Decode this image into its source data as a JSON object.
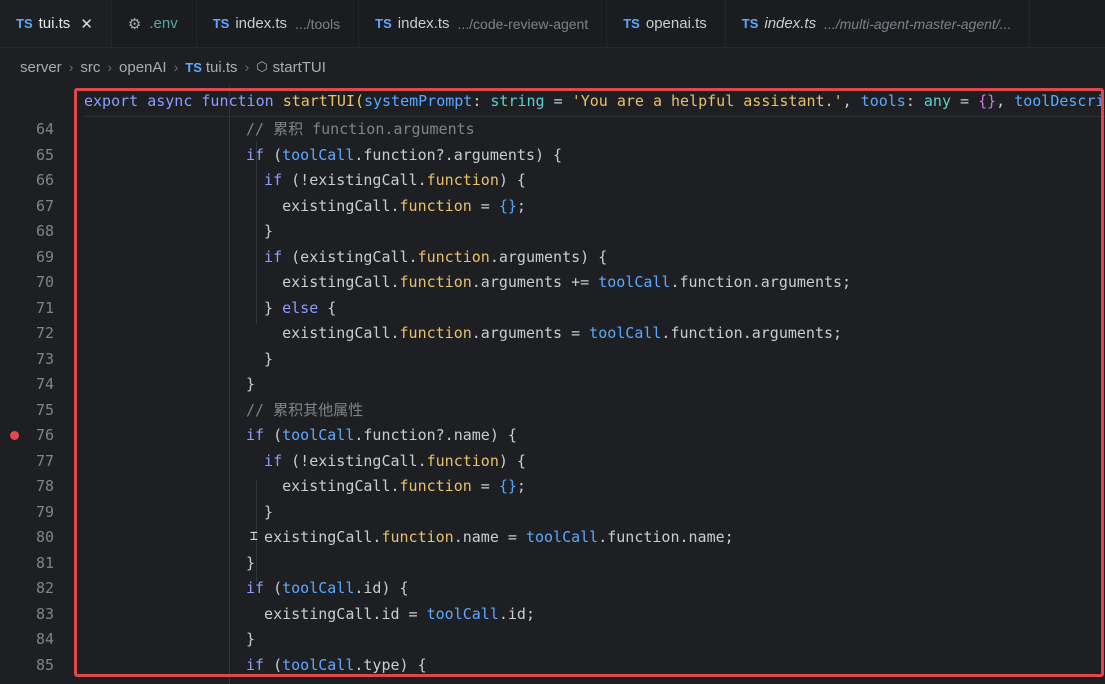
{
  "tabs": [
    {
      "lang": "TS",
      "label": "tui.ts",
      "hint": "",
      "active": true,
      "close": "✕"
    },
    {
      "lang": "⚙",
      "label": ".env",
      "hint": "",
      "active": false
    },
    {
      "lang": "TS",
      "label": "index.ts",
      "hint": ".../tools",
      "active": false
    },
    {
      "lang": "TS",
      "label": "index.ts",
      "hint": ".../code-review-agent",
      "active": false
    },
    {
      "lang": "TS",
      "label": "openai.ts",
      "hint": "",
      "active": false
    },
    {
      "lang": "TS",
      "label": "index.ts",
      "hint": ".../multi-agent-master-agent/...",
      "active": false
    }
  ],
  "breadcrumb": {
    "items": [
      "server",
      "src",
      "openAI",
      "tui.ts",
      "startTUI"
    ],
    "file_lang": "TS",
    "symbol_icon": "cube-icon"
  },
  "sticky_header": "export async function startTUI(systemPrompt: string = 'You are a helpful assistant.', tools: any = {}, toolDescri",
  "breakpoint_line": 76,
  "lines": [
    {
      "n": 64,
      "text": "// 累积 function.arguments"
    },
    {
      "n": 65,
      "text": "if (toolCall.function?.arguments) {"
    },
    {
      "n": 66,
      "text": "if (!existingCall.function) {"
    },
    {
      "n": 67,
      "text": "existingCall.function = {};"
    },
    {
      "n": 68,
      "text": "}"
    },
    {
      "n": 69,
      "text": "if (existingCall.function.arguments) {"
    },
    {
      "n": 70,
      "text": "existingCall.function.arguments += toolCall.function.arguments;"
    },
    {
      "n": 71,
      "text": "} else {"
    },
    {
      "n": 72,
      "text": "existingCall.function.arguments = toolCall.function.arguments;"
    },
    {
      "n": 73,
      "text": "}"
    },
    {
      "n": 74,
      "text": "}"
    },
    {
      "n": 75,
      "text": "// 累积其他属性"
    },
    {
      "n": 76,
      "text": "if (toolCall.function?.name) {"
    },
    {
      "n": 77,
      "text": "if (!existingCall.function) {"
    },
    {
      "n": 78,
      "text": "existingCall.function = {};"
    },
    {
      "n": 79,
      "text": "}"
    },
    {
      "n": 80,
      "text": "existingCall.function.name = toolCall.function.name;"
    },
    {
      "n": 81,
      "text": "}"
    },
    {
      "n": 82,
      "text": "if (toolCall.id) {"
    },
    {
      "n": 83,
      "text": "existingCall.id = toolCall.id;"
    },
    {
      "n": 84,
      "text": "}"
    },
    {
      "n": 85,
      "text": "if (toolCall.type) {"
    }
  ],
  "colors": {
    "highlight_border": "#e0474c",
    "breakpoint": "#e5484d",
    "keyword": "#8c9cff",
    "variable": "#5aa8ff"
  }
}
